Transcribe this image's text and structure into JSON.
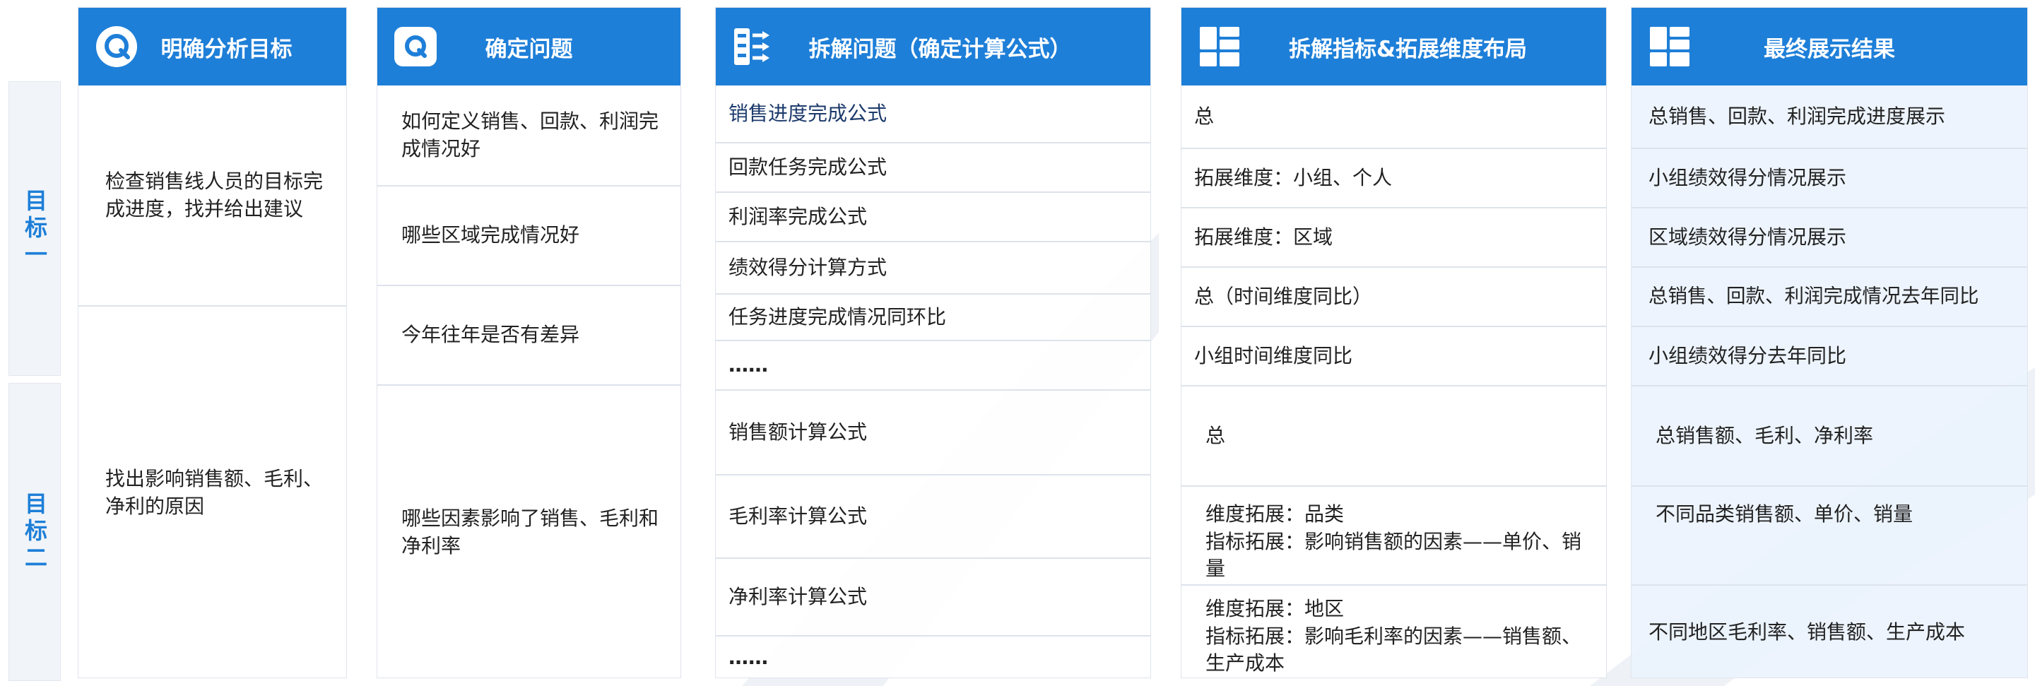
{
  "colors": {
    "header": "#1e7fd8",
    "row_label": "#1e7fd8"
  },
  "row_labels": [
    "目标一",
    "目标二"
  ],
  "columns": [
    {
      "title": "明确分析目标",
      "icon": "target-q-icon",
      "cells": [
        "检查销售线人员的目标完成进度，找并给出建议",
        "找出影响销售额、毛利、净利的原因"
      ]
    },
    {
      "title": "确定问题",
      "icon": "q-badge-icon",
      "cells": [
        "如何定义销售、回款、利润完成情况好",
        "哪些区域完成情况好",
        "今年往年是否有差异",
        "哪些因素影响了销售、毛利和净利率"
      ]
    },
    {
      "title": "拆解问题（确定计算公式）",
      "icon": "split-icon",
      "cells": [
        "销售进度完成公式",
        "回款任务完成公式",
        "利润率完成公式",
        "绩效得分计算方式",
        "任务进度完成情况同环比",
        "……",
        "销售额计算公式",
        "毛利率计算公式",
        "净利率计算公式",
        "……"
      ]
    },
    {
      "title": "拆解指标&拓展维度布局",
      "icon": "layout-icon",
      "cells": [
        "总",
        "拓展维度：小组、个人",
        "拓展维度：区域",
        "总（时间维度同比）",
        "小组时间维度同比",
        "总",
        "维度拓展：品类\n指标拓展：影响销售额的因素——单价、销量",
        "维度拓展：地区\n指标拓展：影响毛利率的因素——销售额、生产成本"
      ]
    },
    {
      "title": "最终展示结果",
      "icon": "layout-icon",
      "cells": [
        "总销售、回款、利润完成进度展示",
        "小组绩效得分情况展示",
        "区域绩效得分情况展示",
        "总销售、回款、利润完成情况去年同比",
        "小组绩效得分去年同比",
        "总销售额、毛利、净利率",
        "不同品类销售额、单价、销量",
        "不同地区毛利率、销售额、生产成本"
      ]
    }
  ]
}
